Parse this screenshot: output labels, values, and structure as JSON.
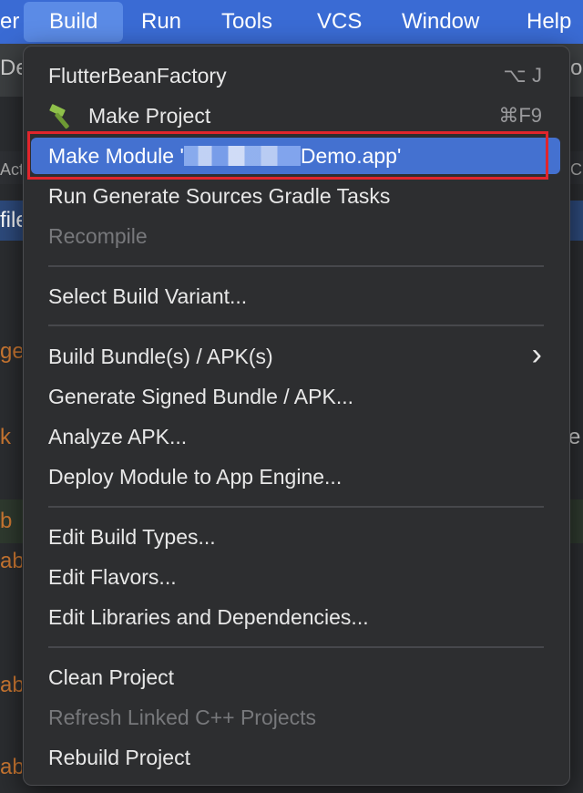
{
  "menubar": {
    "items": [
      {
        "label": "er"
      },
      {
        "label": "Build"
      },
      {
        "label": "Run"
      },
      {
        "label": "Tools"
      },
      {
        "label": "VCS"
      },
      {
        "label": "Window"
      },
      {
        "label": "Help"
      }
    ]
  },
  "background": {
    "fragments": [
      "De",
      "ol",
      "Act",
      "nC",
      "file",
      "ge",
      "k",
      "e",
      "b",
      "ab",
      "ab",
      "ab"
    ]
  },
  "build_menu": {
    "items": [
      {
        "label": "FlutterBeanFactory",
        "shortcut": "⌥ J"
      },
      {
        "label": "Make Project",
        "shortcut": "⌘F9",
        "icon": "hammer-icon"
      },
      {
        "label_prefix": "Make Module '",
        "label_suffix": "Demo.app'"
      },
      {
        "label": "Run Generate Sources Gradle Tasks"
      },
      {
        "label": "Recompile"
      },
      {
        "label": "Select Build Variant..."
      },
      {
        "label": "Build Bundle(s) / APK(s)",
        "submenu_arrow": "›"
      },
      {
        "label": "Generate Signed Bundle / APK..."
      },
      {
        "label": "Analyze APK..."
      },
      {
        "label": "Deploy Module to App Engine..."
      },
      {
        "label": "Edit Build Types..."
      },
      {
        "label": "Edit Flavors..."
      },
      {
        "label": "Edit Libraries and Dependencies..."
      },
      {
        "label": "Clean Project"
      },
      {
        "label": "Refresh Linked C++ Projects"
      },
      {
        "label": "Rebuild Project"
      }
    ]
  },
  "colors": {
    "menubar": "#3a6bd4",
    "selected_item": "#4471d0",
    "highlight_box": "#e0252c",
    "menu_bg": "#2d2e30"
  }
}
